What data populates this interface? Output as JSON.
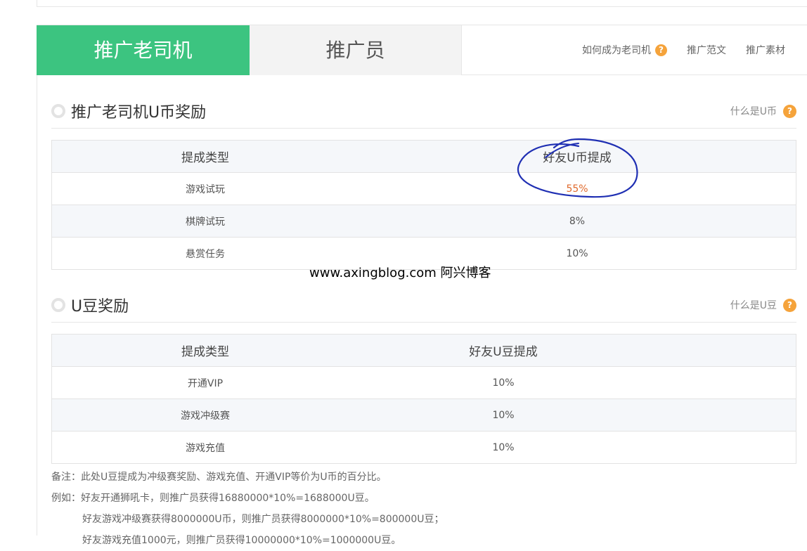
{
  "tabs": {
    "active_label": "推广老司机",
    "inactive_label": "推广员",
    "links": [
      {
        "label": "如何成为老司机",
        "has_help_icon": true
      },
      {
        "label": "推广范文"
      },
      {
        "label": "推广素材"
      }
    ]
  },
  "help_icon_glyph": "?",
  "section1": {
    "title": "推广老司机U币奖励",
    "help_label": "什么是U币",
    "columns": [
      "提成类型",
      "好友U币提成"
    ],
    "rows": [
      {
        "type": "游戏试玩",
        "rate": "55%"
      },
      {
        "type": "棋牌试玩",
        "rate": "8%"
      },
      {
        "type": "悬赏任务",
        "rate": "10%"
      }
    ]
  },
  "watermark": "www.axingblog.com 阿兴博客",
  "section2": {
    "title": "U豆奖励",
    "help_label": "什么是U豆",
    "columns": [
      "提成类型",
      "好友U豆提成"
    ],
    "rows": [
      {
        "type": "开通VIP",
        "rate": "10%"
      },
      {
        "type": "游戏冲级赛",
        "rate": "10%"
      },
      {
        "type": "游戏充值",
        "rate": "10%"
      }
    ]
  },
  "notes": {
    "line1": "备注：此处U豆提成为冲级赛奖励、游戏充值、开通VIP等价为U币的百分比。",
    "line2": "例如：好友开通狮吼卡，则推广员获得16880000*10%=1688000U豆。",
    "line3": "好友游戏冲级赛获得8000000U币，则推广员获得8000000*10%=800000U豆；",
    "line4": "好友游戏充值1000元，则推广员获得10000000*10%=1000000U豆。"
  },
  "colors": {
    "accent_green": "#3cc480",
    "help_orange": "#f5a33b",
    "highlight_orange": "#e06a2c",
    "annotation_blue": "#1f2fb3"
  }
}
